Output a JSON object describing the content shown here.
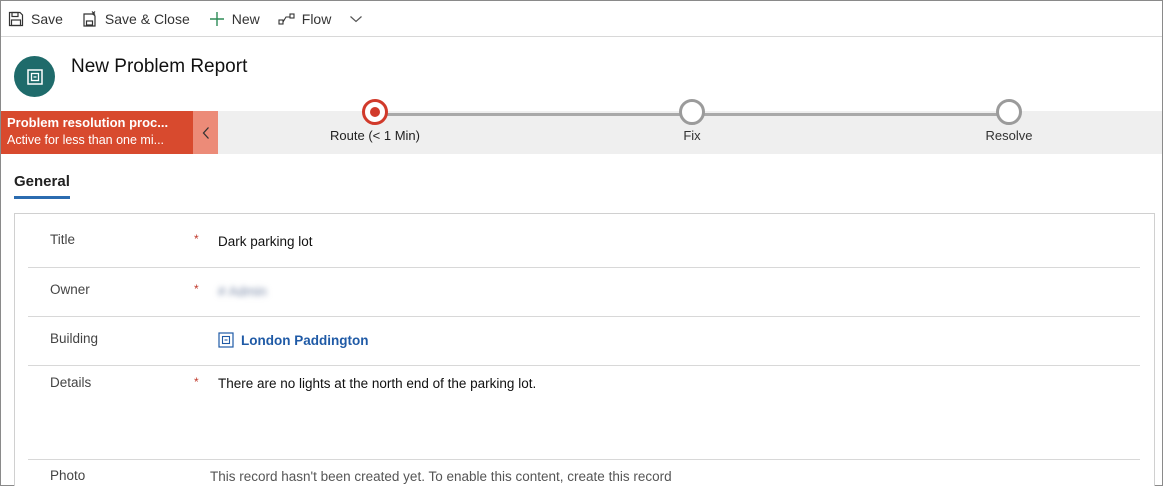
{
  "toolbar": {
    "save": "Save",
    "save_close": "Save & Close",
    "new": "New",
    "flow": "Flow"
  },
  "header": {
    "title": "New Problem Report"
  },
  "process": {
    "name": "Problem resolution proc...",
    "status": "Active for less than one mi...",
    "stages": [
      {
        "label": "Route  (< 1 Min)",
        "active": true
      },
      {
        "label": "Fix",
        "active": false
      },
      {
        "label": "Resolve",
        "active": false
      }
    ]
  },
  "tabs": {
    "general": "General"
  },
  "form": {
    "title": {
      "label": "Title",
      "required": "*",
      "value": "Dark parking lot"
    },
    "owner": {
      "label": "Owner",
      "required": "*",
      "value": "# Admin"
    },
    "building": {
      "label": "Building",
      "value": "London Paddington"
    },
    "details": {
      "label": "Details",
      "required": "*",
      "value": "There are no lights at the north end of the parking lot."
    },
    "photo": {
      "label": "Photo",
      "note": "This record hasn't been created yet. To enable this content, create this record"
    }
  },
  "colors": {
    "process_flyout": "#d84a2e",
    "active_stage": "#d13a2b",
    "link": "#1f5aa6",
    "avatar": "#1f6b6b"
  }
}
